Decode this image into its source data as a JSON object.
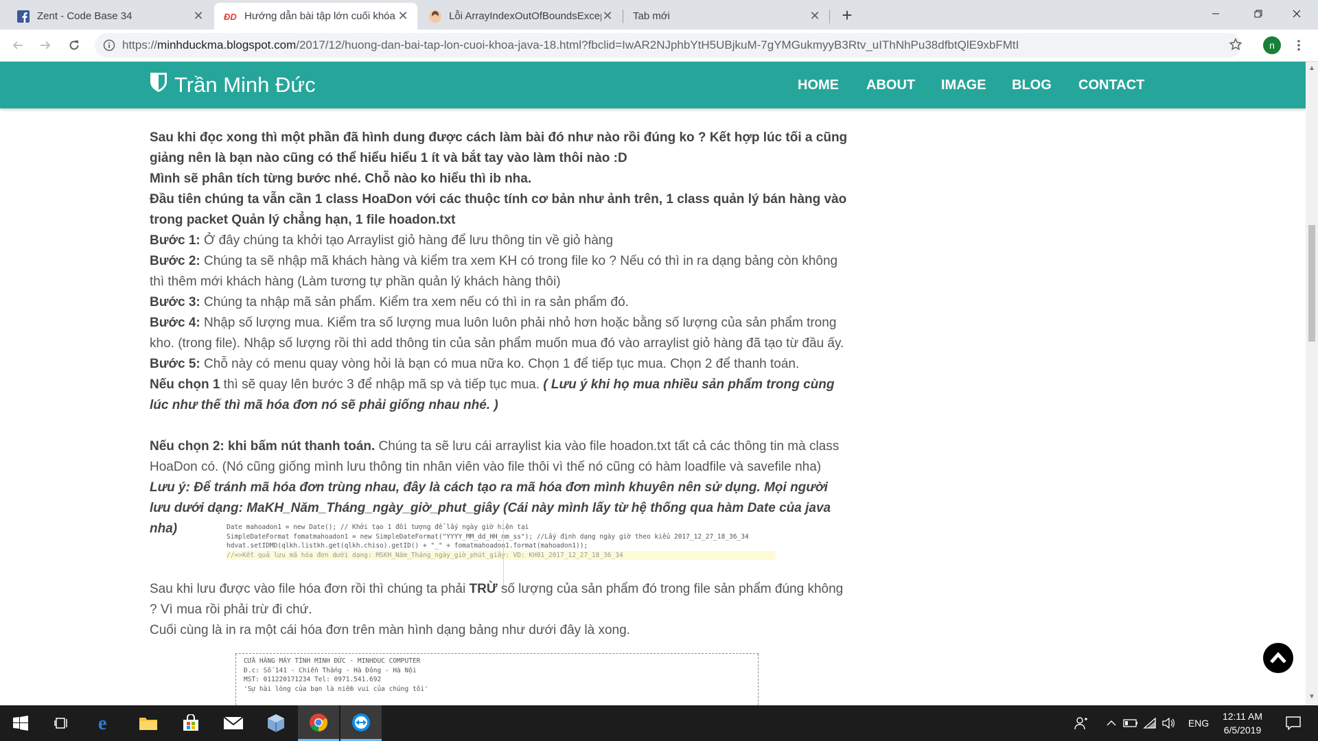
{
  "browser": {
    "tabs": [
      {
        "title": "Zent - Code Base 34",
        "icon": "facebook-icon",
        "active": false
      },
      {
        "title": "Hướng dẫn bài tập lớn cuối khóa",
        "icon": "blog-favicon",
        "active": true
      },
      {
        "title": "Lỗi ArrayIndexOutOfBoundsException",
        "icon": "avatar-favicon",
        "active": false
      },
      {
        "title": "Tab mới",
        "icon": "",
        "active": false
      }
    ],
    "url_scheme": "https://",
    "url_host": "minhduckma.blogspot.com",
    "url_path": "/2017/12/huong-dan-bai-tap-lon-cuoi-khoa-java-18.html?fbclid=IwAR2NJphbYtH5UBjkuM-7gYMGukmyyB3Rtv_uIThNhPu38dfbtQlE9xbFMtI",
    "profile_initial": "n"
  },
  "site": {
    "brand": "Trần Minh Đức",
    "nav": [
      "HOME",
      "ABOUT",
      "IMAGE",
      "BLOG",
      "CONTACT"
    ]
  },
  "article": {
    "p1": "Sau khi đọc xong thì một phần đã hình dung được cách làm bài đó như nào rồi đúng ko ? Kết hợp lúc tối a cũng giảng nên là bạn nào cũng có thể hiểu hiểu 1 ít và bắt tay vào làm thôi nào :D",
    "p2": "Mình sẽ phân tích từng bước nhé. Chỗ nào ko hiểu thì ib nha.",
    "p3": "Đầu tiên chúng ta vẫn cần 1 class HoaDon với các thuộc tính cơ bản như ảnh trên, 1 class quản lý bán hàng vào trong packet Quản lý chẳng hạn, 1 file hoadon.txt",
    "steps": [
      {
        "label": "Bước 1:",
        "text": " Ở đây chúng ta khởi tạo Arraylist giỏ hàng để lưu thông tin về giỏ hàng"
      },
      {
        "label": "Bước 2:",
        "text": " Chúng ta sẽ nhập mã khách hàng và kiểm tra xem KH có trong file ko ? Nếu có thì in ra dạng bảng còn không thì thêm mới khách hàng (Làm tương tự phần quản lý khách hàng thôi)"
      },
      {
        "label": "Bước 3:",
        "text": " Chúng ta nhập mã sản phẩm. Kiểm tra xem nếu có thì in ra sản phẩm đó."
      },
      {
        "label": "Bước 4:",
        "text": " Nhập số lượng mua. Kiểm tra số lượng mua luôn luôn phải nhỏ hơn hoặc bằng số lượng của sản phẩm trong kho. (trong file). Nhập số lượng rồi thì add thông tin của sản phẩm muốn mua đó vào arraylist giỏ hàng đã tạo từ đầu ấy."
      },
      {
        "label": "Bước 5:",
        "text": " Chỗ này có menu quay vòng hỏi là bạn có mua nữa ko. Chọn 1 để tiếp tục mua. Chọn 2 để thanh toán."
      }
    ],
    "choice1_label": "Nếu chọn 1",
    "choice1_text": " thì sẽ quay lên bước 3 để nhập mã sp và tiếp tục mua. ",
    "choice1_note": "( Lưu ý khi họ mua nhiều sản phẩm trong cùng lúc như thế thì mã hóa đơn nó sẽ phải giống nhau nhé. )",
    "choice2_label": "Nếu chọn 2: khi bấm nút thanh toán.",
    "choice2_text": " Chúng ta sẽ lưu cái arraylist kia vào file hoadon.txt tất cả các thông tin mà class HoaDon có. (Nó cũng giống mình lưu thông tin nhân viên vào file thôi vì thế nó cũng có hàm loadfile và savefile nha)",
    "note": "Lưu ý: Để tránh mã hóa đơn trùng nhau, đây là cách tạo ra mã hóa đơn mình khuyên nên sử dụng. Mọi người lưu dưới dạng: MaKH_Năm_Tháng_ngày_giờ_phut_giây (Cái này mình lấy từ hệ thống qua hàm Date của java nha)",
    "after_pre": "Sau khi lưu được vào file hóa đơn rồi thì chúng ta phải ",
    "after_bold": "TRỪ",
    "after_post": " số lượng của sản phẩm đó trong file sản phẩm đúng không ? Vì mua rồi phải trừ đi chứ.",
    "final": "Cuối cùng là in ra một cái hóa đơn trên màn hình dạng bảng như dưới đây là xong.",
    "code_lines": [
      "Date mahoadon1 = new Date(); // Khởi tạo 1 đối tượng để lấy ngày giờ hiện tại",
      "SimpleDateFormat fomatmahoadon1 = new SimpleDateFormat(\"YYYY_MM_dd_HH_mm_ss\"); //Lấy định dạng ngày giờ theo kiểu 2017_12_27_18_36_34",
      "hdvat.setIDMD(qlkh.listkh.get(qlkh.chiso).getID() + \"_\" + fomatmahoadon1.format(mahoadon1));",
      "//=>Kết quả lưu mã hóa đơn dưới dạng: MSKH_Năm_Tháng_ngày_giờ_phút_giây: VD: KH01_2017_12_27_18_36_34"
    ],
    "receipt_lines": [
      "CỬA HÀNG MÁY TÍNH MINH ĐỨC - MINHDUC COMPUTER",
      " Đ.c: Số 141 - Chiến Thắng - Hà Đông - Hà Nội",
      "    MST: 011220171234  Tel: 0971.541.692",
      "'Sự hài lòng của bạn là niềm vui của chúng tôi'"
    ]
  },
  "taskbar": {
    "lang": "ENG",
    "time": "12:11 AM",
    "date": "6/5/2019"
  }
}
